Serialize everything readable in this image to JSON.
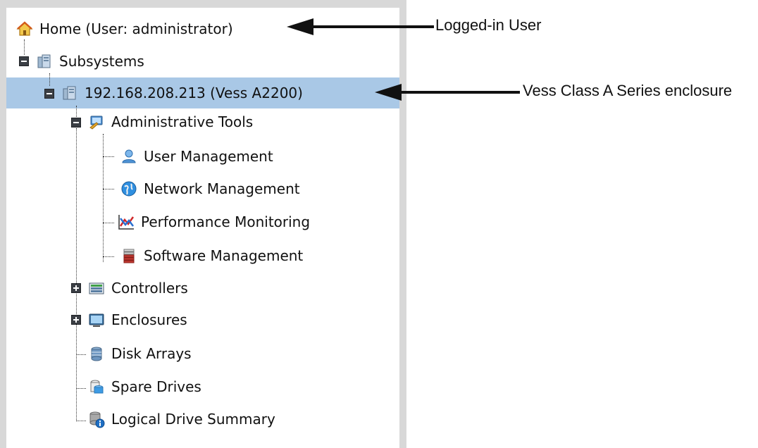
{
  "tree": {
    "home": "Home (User: administrator)",
    "subsystems": "Subsystems",
    "enclosure_node": "192.168.208.213 (Vess A2200)",
    "admin_tools": "Administrative Tools",
    "user_mgmt": "User Management",
    "network_mgmt": "Network Management",
    "perf_monitoring": "Performance Monitoring",
    "software_mgmt": "Software Management",
    "controllers": "Controllers",
    "enclosures": "Enclosures",
    "disk_arrays": "Disk Arrays",
    "spare_drives": "Spare Drives",
    "logical_drive_summary": "Logical Drive Summary"
  },
  "annotations": {
    "logged_in_user": "Logged-in User",
    "enclosure": "Vess Class A Series enclosure"
  },
  "icons": [
    "home-icon",
    "subsystems-icon",
    "enclosure-server-icon",
    "admin-tools-icon",
    "user-icon",
    "network-globe-icon",
    "performance-chart-icon",
    "software-stack-icon",
    "controllers-icon",
    "enclosures-monitor-icon",
    "disk-arrays-icon",
    "spare-drives-icon",
    "logical-drive-info-icon"
  ],
  "colors": {
    "selection": "#a9c8e6",
    "panel_border": "#d8d8d8"
  }
}
